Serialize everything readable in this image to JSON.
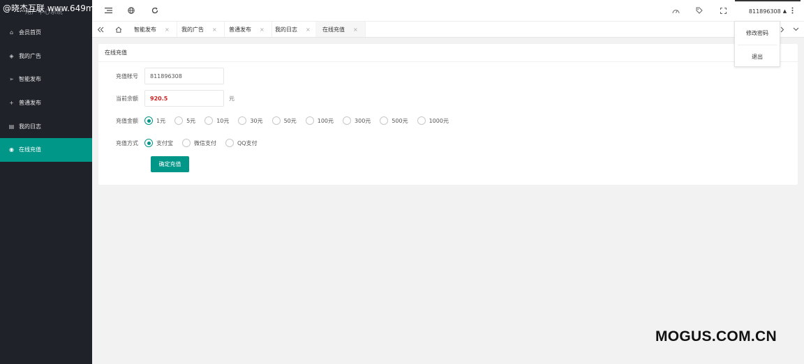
{
  "watermarks": {
    "top": "@晓杰互联 www.649m",
    "bottom": "MOGUS.COM.CN"
  },
  "app": {
    "logo_text": "用户中心系统"
  },
  "sidebar": {
    "items": [
      {
        "label": "会员首页",
        "icon": "home-icon",
        "glyph": "⌂"
      },
      {
        "label": "我的广告",
        "icon": "diamond-icon",
        "glyph": "◈"
      },
      {
        "label": "智能发布",
        "icon": "send-icon",
        "glyph": "➢"
      },
      {
        "label": "普通发布",
        "icon": "plus-icon",
        "glyph": "+"
      },
      {
        "label": "我的日志",
        "icon": "log-icon",
        "glyph": "▤"
      },
      {
        "label": "在线充值",
        "icon": "recharge-icon",
        "glyph": "◉",
        "active": true
      }
    ]
  },
  "header": {
    "icons": [
      "menu-toggle-icon",
      "globe-icon",
      "refresh-icon",
      "dashboard-icon",
      "tag-icon",
      "fullscreen-icon",
      "more-icon"
    ],
    "username": "811896308"
  },
  "user_dropdown": {
    "items": [
      "修改密码",
      "退出"
    ]
  },
  "tabs": {
    "items": [
      {
        "label": "智能发布"
      },
      {
        "label": "我的广告"
      },
      {
        "label": "普通发布"
      },
      {
        "label": "我的日志"
      },
      {
        "label": "在线充值",
        "active": true
      }
    ]
  },
  "card": {
    "title": "在线充值",
    "account_label": "充值帐号",
    "account_value": "811896308",
    "balance_label": "当前余额",
    "balance_value": "920.5",
    "balance_unit": "元",
    "amount_label": "充值金额",
    "amounts": [
      "1元",
      "5元",
      "10元",
      "30元",
      "50元",
      "100元",
      "300元",
      "500元",
      "1000元"
    ],
    "amount_selected": 0,
    "method_label": "充值方式",
    "methods": [
      "支付宝",
      "微信支付",
      "QQ支付"
    ],
    "method_selected": 0,
    "submit_label": "确定充值"
  },
  "colors": {
    "accent": "#009688",
    "sidebar_bg": "#20222a",
    "balance": "#cc2222"
  }
}
